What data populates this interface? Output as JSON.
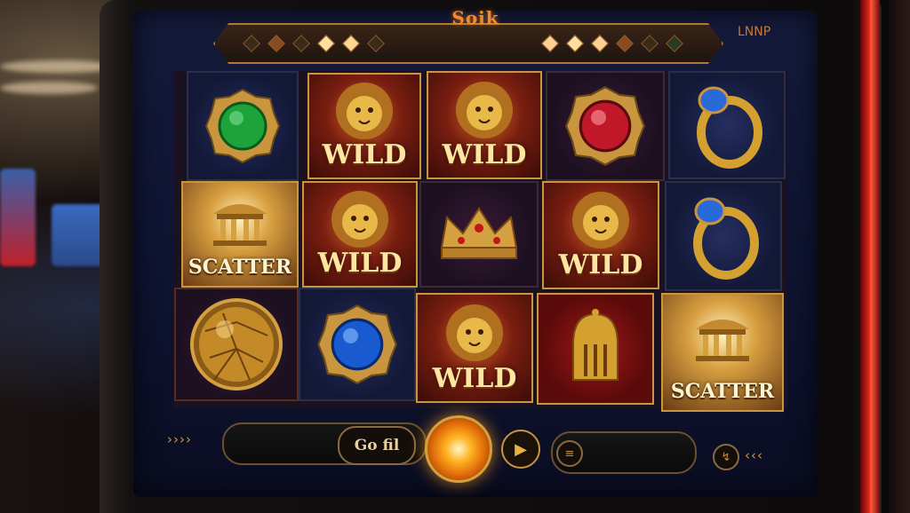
{
  "header": {
    "title": "Soik",
    "top_right": "LNNP"
  },
  "reels": [
    [
      "green-gem",
      "scatter",
      "gold-ball"
    ],
    [
      "wild",
      "wild",
      "blue-gem"
    ],
    [
      "wild",
      "crown",
      "wild"
    ],
    [
      "red-gem",
      "wild",
      "golden-helmet"
    ],
    [
      "blue-ring",
      "blue-ring",
      "scatter"
    ]
  ],
  "symbols": {
    "wild_label": "WILD",
    "scatter_label": "SCATTER"
  },
  "controls": {
    "left_arrows": "››››",
    "go_button_label": "Go fil",
    "play_icon": "▶",
    "right_arrows": "‹‹‹",
    "settings_icon": "↯"
  },
  "colors": {
    "accent": "#c9953e",
    "spin_glow": "#ffb020",
    "screen_bg": "#141a3a",
    "cabinet_red": "#e0241c"
  }
}
